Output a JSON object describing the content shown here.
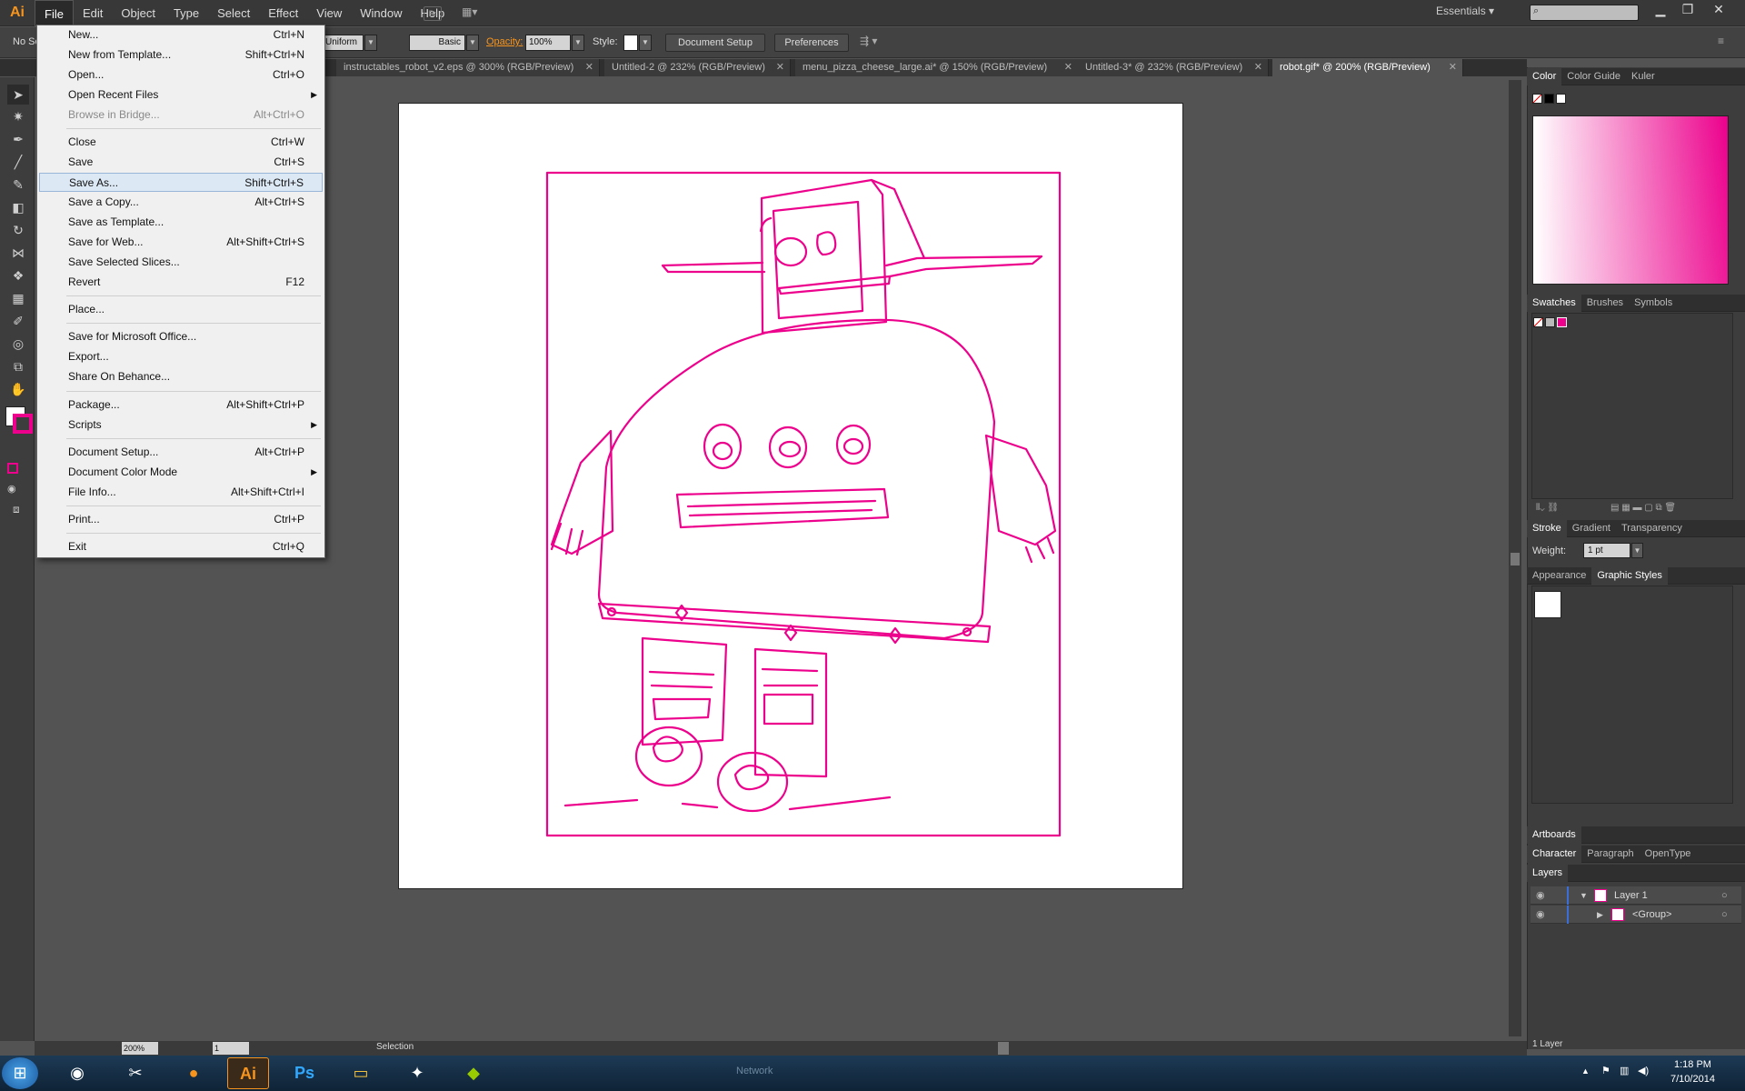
{
  "app": {
    "logo": "Ai",
    "workspace": "Essentials ▾"
  },
  "menubar": [
    "File",
    "Edit",
    "Object",
    "Type",
    "Select",
    "Effect",
    "View",
    "Window",
    "Help"
  ],
  "control": {
    "selection_label": "No Se",
    "stroke_profile": "Uniform",
    "brush": "Basic",
    "opacity_label": "Opacity:",
    "opacity_value": "100%",
    "style_label": "Style:",
    "doc_setup": "Document Setup",
    "preferences": "Preferences"
  },
  "tabs": [
    {
      "label": "instructables_robot_v2.eps @ 300% (RGB/Preview)"
    },
    {
      "label": "Untitled-2 @ 232% (RGB/Preview)"
    },
    {
      "label": "menu_pizza_cheese_large.ai* @ 150% (RGB/Preview)"
    },
    {
      "label": "Untitled-3* @ 232% (RGB/Preview)"
    },
    {
      "label": "robot.gif* @ 200% (RGB/Preview)"
    }
  ],
  "file_menu": [
    {
      "label": "New...",
      "shortcut": "Ctrl+N"
    },
    {
      "label": "New from Template...",
      "shortcut": "Shift+Ctrl+N"
    },
    {
      "label": "Open...",
      "shortcut": "Ctrl+O"
    },
    {
      "label": "Open Recent Files",
      "shortcut": ""
    },
    {
      "label": "Browse in Bridge...",
      "shortcut": "Alt+Ctrl+O"
    },
    {
      "label": "Close",
      "shortcut": "Ctrl+W"
    },
    {
      "label": "Save",
      "shortcut": "Ctrl+S"
    },
    {
      "label": "Save As...",
      "shortcut": "Shift+Ctrl+S"
    },
    {
      "label": "Save a Copy...",
      "shortcut": "Alt+Ctrl+S"
    },
    {
      "label": "Save as Template...",
      "shortcut": ""
    },
    {
      "label": "Save for Web...",
      "shortcut": "Alt+Shift+Ctrl+S"
    },
    {
      "label": "Save Selected Slices...",
      "shortcut": ""
    },
    {
      "label": "Revert",
      "shortcut": "F12"
    },
    {
      "label": "Place...",
      "shortcut": ""
    },
    {
      "label": "Save for Microsoft Office...",
      "shortcut": ""
    },
    {
      "label": "Export...",
      "shortcut": ""
    },
    {
      "label": "Share On Behance...",
      "shortcut": ""
    },
    {
      "label": "Package...",
      "shortcut": "Alt+Shift+Ctrl+P"
    },
    {
      "label": "Scripts",
      "shortcut": ""
    },
    {
      "label": "Document Setup...",
      "shortcut": "Alt+Ctrl+P"
    },
    {
      "label": "Document Color Mode",
      "shortcut": ""
    },
    {
      "label": "File Info...",
      "shortcut": "Alt+Shift+Ctrl+I"
    },
    {
      "label": "Print...",
      "shortcut": "Ctrl+P"
    },
    {
      "label": "Exit",
      "shortcut": "Ctrl+Q"
    }
  ],
  "panels": {
    "color_tabs": [
      "Color",
      "Color Guide",
      "Kuler"
    ],
    "swatch_tabs": [
      "Swatches",
      "Brushes",
      "Symbols"
    ],
    "stroke_tabs": [
      "Stroke",
      "Gradient",
      "Transparency"
    ],
    "weight_label": "Weight:",
    "weight_value": "1 pt",
    "appearance_tabs": [
      "Appearance",
      "Graphic Styles"
    ],
    "artboards": "Artboards",
    "char_tabs": [
      "Character",
      "Paragraph",
      "OpenType"
    ],
    "layers_title": "Layers",
    "layers": [
      {
        "name": "Layer 1"
      },
      {
        "name": "<Group>"
      }
    ],
    "layers_count": "1 Layer"
  },
  "status": {
    "zoom": "200%",
    "page": "1",
    "tool": "Selection"
  },
  "taskbar": {
    "time": "1:18 PM",
    "date": "7/10/2014",
    "network": "Network"
  },
  "colors": {
    "accent": "#ec008c",
    "menu_bg": "#f0f0f0",
    "ui_bg": "#535353"
  }
}
